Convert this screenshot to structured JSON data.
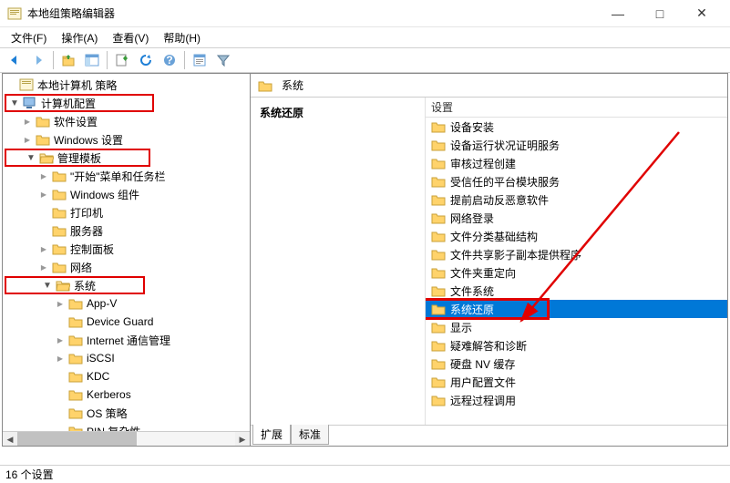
{
  "window": {
    "title": "本地组策略编辑器",
    "min": "—",
    "max": "□",
    "close": "✕"
  },
  "menu": {
    "file": "文件(F)",
    "action": "操作(A)",
    "view": "查看(V)",
    "help": "帮助(H)"
  },
  "tree": {
    "root": "本地计算机 策略",
    "computer_config": "计算机配置",
    "software_settings": "软件设置",
    "windows_settings": "Windows 设置",
    "admin_templates": "管理模板",
    "start_menu": "\"开始\"菜单和任务栏",
    "win_components": "Windows 组件",
    "printers": "打印机",
    "server": "服务器",
    "control_panel": "控制面板",
    "network": "网络",
    "system": "系统",
    "appv": "App-V",
    "device_guard": "Device Guard",
    "internet_comm": "Internet 通信管理",
    "iscsi": "iSCSI",
    "kdc": "KDC",
    "kerberos": "Kerberos",
    "os_policies": "OS 策略",
    "pin_complexity": "PIN 复杂性"
  },
  "right": {
    "header": "系统",
    "page_title": "系统还原",
    "column": "设置",
    "items": [
      "设备安装",
      "设备运行状况证明服务",
      "审核过程创建",
      "受信任的平台模块服务",
      "提前启动反恶意软件",
      "网络登录",
      "文件分类基础结构",
      "文件共享影子副本提供程序",
      "文件夹重定向",
      "文件系统",
      "系统还原",
      "显示",
      "疑难解答和诊断",
      "硬盘 NV 缓存",
      "用户配置文件",
      "远程过程调用"
    ],
    "selected_index": 10
  },
  "tabs": {
    "extended": "扩展",
    "standard": "标准"
  },
  "status": {
    "text": "16 个设置"
  },
  "icons": {
    "chevron_right": "▶",
    "chevron_down": "▼"
  }
}
